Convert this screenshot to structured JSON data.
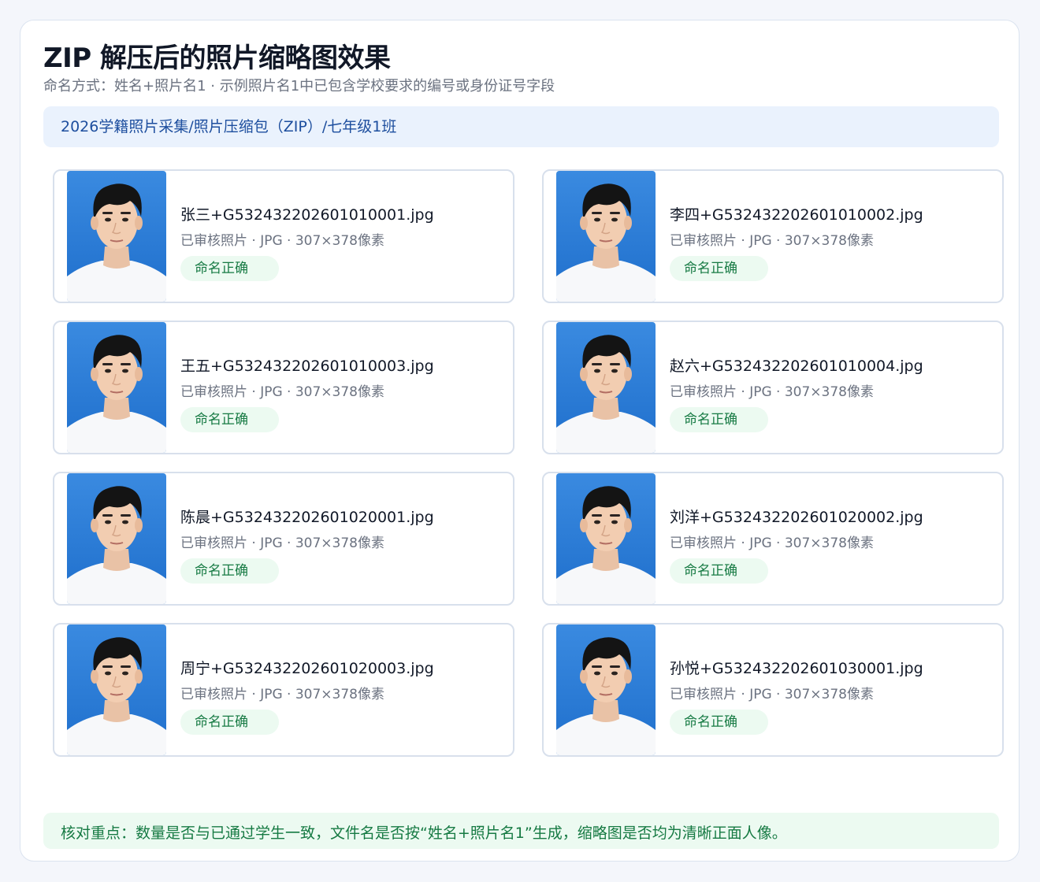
{
  "header": {
    "title": "ZIP 解压后的照片缩略图效果",
    "subtitle": "命名方式：姓名+照片名1 · 示例照片名1中已包含学校要求的编号或身份证号字段"
  },
  "path": "2026学籍照片采集/照片压缩包（ZIP）/七年级1班",
  "photos": [
    {
      "filename": "张三+G532432202601010001.jpg",
      "meta": "已审核照片 · JPG · 307×378像素",
      "status": "命名正确"
    },
    {
      "filename": "李四+G532432202601010002.jpg",
      "meta": "已审核照片 · JPG · 307×378像素",
      "status": "命名正确"
    },
    {
      "filename": "王五+G532432202601010003.jpg",
      "meta": "已审核照片 · JPG · 307×378像素",
      "status": "命名正确"
    },
    {
      "filename": "赵六+G532432202601010004.jpg",
      "meta": "已审核照片 · JPG · 307×378像素",
      "status": "命名正确"
    },
    {
      "filename": "陈晨+G532432202601020001.jpg",
      "meta": "已审核照片 · JPG · 307×378像素",
      "status": "命名正确"
    },
    {
      "filename": "刘洋+G532432202601020002.jpg",
      "meta": "已审核照片 · JPG · 307×378像素",
      "status": "命名正确"
    },
    {
      "filename": "周宁+G532432202601020003.jpg",
      "meta": "已审核照片 · JPG · 307×378像素",
      "status": "命名正确"
    },
    {
      "filename": "孙悦+G532432202601030001.jpg",
      "meta": "已审核照片 · JPG · 307×378像素",
      "status": "命名正确"
    }
  ],
  "note": "核对重点：数量是否与已通过学生一致，文件名是否按“姓名+照片名1”生成，缩略图是否均为清晰正面人像。",
  "colors": {
    "accent_blue": "#1d4e9e",
    "path_bg": "#eaf2fd",
    "success_green": "#167a43",
    "success_bg": "#ecfaf1",
    "photo_bg": "#2a7fd8"
  }
}
